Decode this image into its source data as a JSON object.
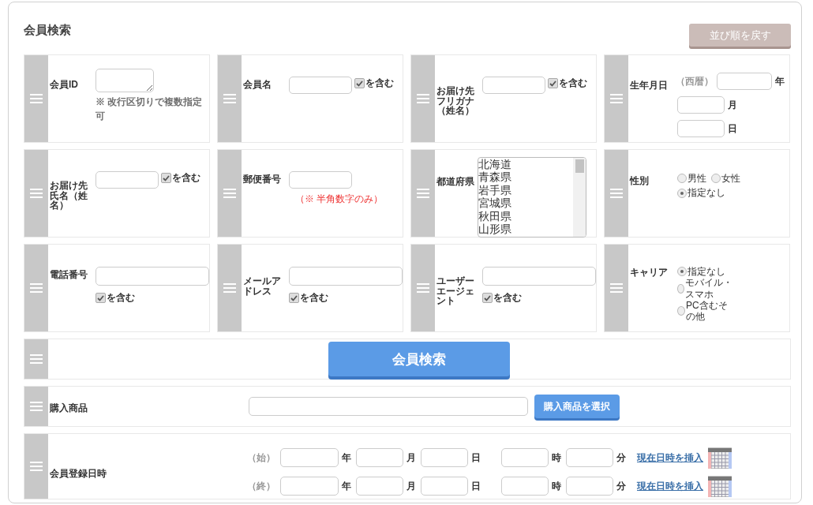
{
  "title": "会員検索",
  "reset_button": "並び順を戻す",
  "cards": [
    {
      "kind": "textarea",
      "label": "会員ID",
      "note": "※ 改行区切りで複数指定可"
    },
    {
      "kind": "text",
      "label": "会員名",
      "checkbox": {
        "label": "を含む",
        "checked": true
      }
    },
    {
      "kind": "text",
      "label": "お届け先フリガナ（姓名）",
      "checkbox": {
        "label": "を含む",
        "checked": true
      }
    },
    {
      "kind": "date",
      "label": "生年月日",
      "prefix": "（西暦）",
      "units": [
        "年",
        "月",
        "日"
      ]
    },
    {
      "kind": "text",
      "label": "お届け先氏名（姓名）",
      "checkbox": {
        "label": "を含む",
        "checked": true
      }
    },
    {
      "kind": "text",
      "label": "郵便番号",
      "note": "（※ 半角数字のみ）"
    },
    {
      "kind": "list",
      "label": "都道府県",
      "options": [
        "北海道",
        "青森県",
        "岩手県",
        "宮城県",
        "秋田県",
        "山形県"
      ]
    },
    {
      "kind": "radio",
      "label": "性別",
      "options": [
        {
          "label": "男性",
          "selected": false
        },
        {
          "label": "女性",
          "selected": false
        },
        {
          "label": "指定なし",
          "selected": true
        }
      ]
    },
    {
      "kind": "wide",
      "label": "電話番号",
      "checkbox": {
        "label": "を含む",
        "checked": true
      }
    },
    {
      "kind": "wide",
      "label": "メールアドレス",
      "checkbox": {
        "label": "を含む",
        "checked": true
      }
    },
    {
      "kind": "wide",
      "label": "ユーザーエージェント",
      "checkbox": {
        "label": "を含む",
        "checked": true
      }
    },
    {
      "kind": "radio",
      "label": "キャリア",
      "options": [
        {
          "label": "指定なし",
          "selected": true
        },
        {
          "label": "モバイル・スマホ",
          "selected": false
        },
        {
          "label": "PC含むその他",
          "selected": false
        }
      ]
    }
  ],
  "search_button": "会員検索",
  "product": {
    "label": "購入商品",
    "button": "購入商品を選択"
  },
  "registration": {
    "label": "会員登録日時",
    "rows": [
      {
        "prefix": "（始）",
        "units": [
          "年",
          "月",
          "日",
          "時",
          "分"
        ],
        "link": "現在日時を挿入"
      },
      {
        "prefix": "（終）",
        "units": [
          "年",
          "月",
          "日",
          "時",
          "分"
        ],
        "link": "現在日時を挿入"
      }
    ]
  }
}
